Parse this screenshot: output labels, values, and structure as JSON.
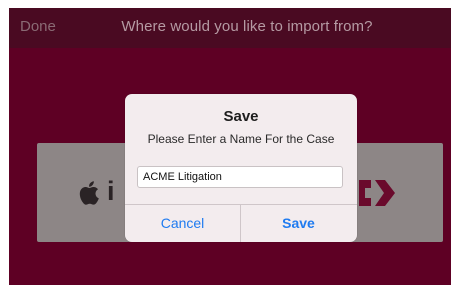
{
  "navbar": {
    "done_label": "Done",
    "title": "Where would you like to import from?"
  },
  "sources": {
    "apple_icon": "apple-icon",
    "apple_text": "i",
    "right_icon": "import-logo-icon"
  },
  "alert": {
    "title": "Save",
    "message": "Please Enter a Name For the Case",
    "input_value": "ACME Litigation",
    "cancel_label": "Cancel",
    "save_label": "Save"
  },
  "colors": {
    "background": "#5e0024",
    "navbar": "#4a0a22",
    "alert_button": "#1f7bf0"
  }
}
